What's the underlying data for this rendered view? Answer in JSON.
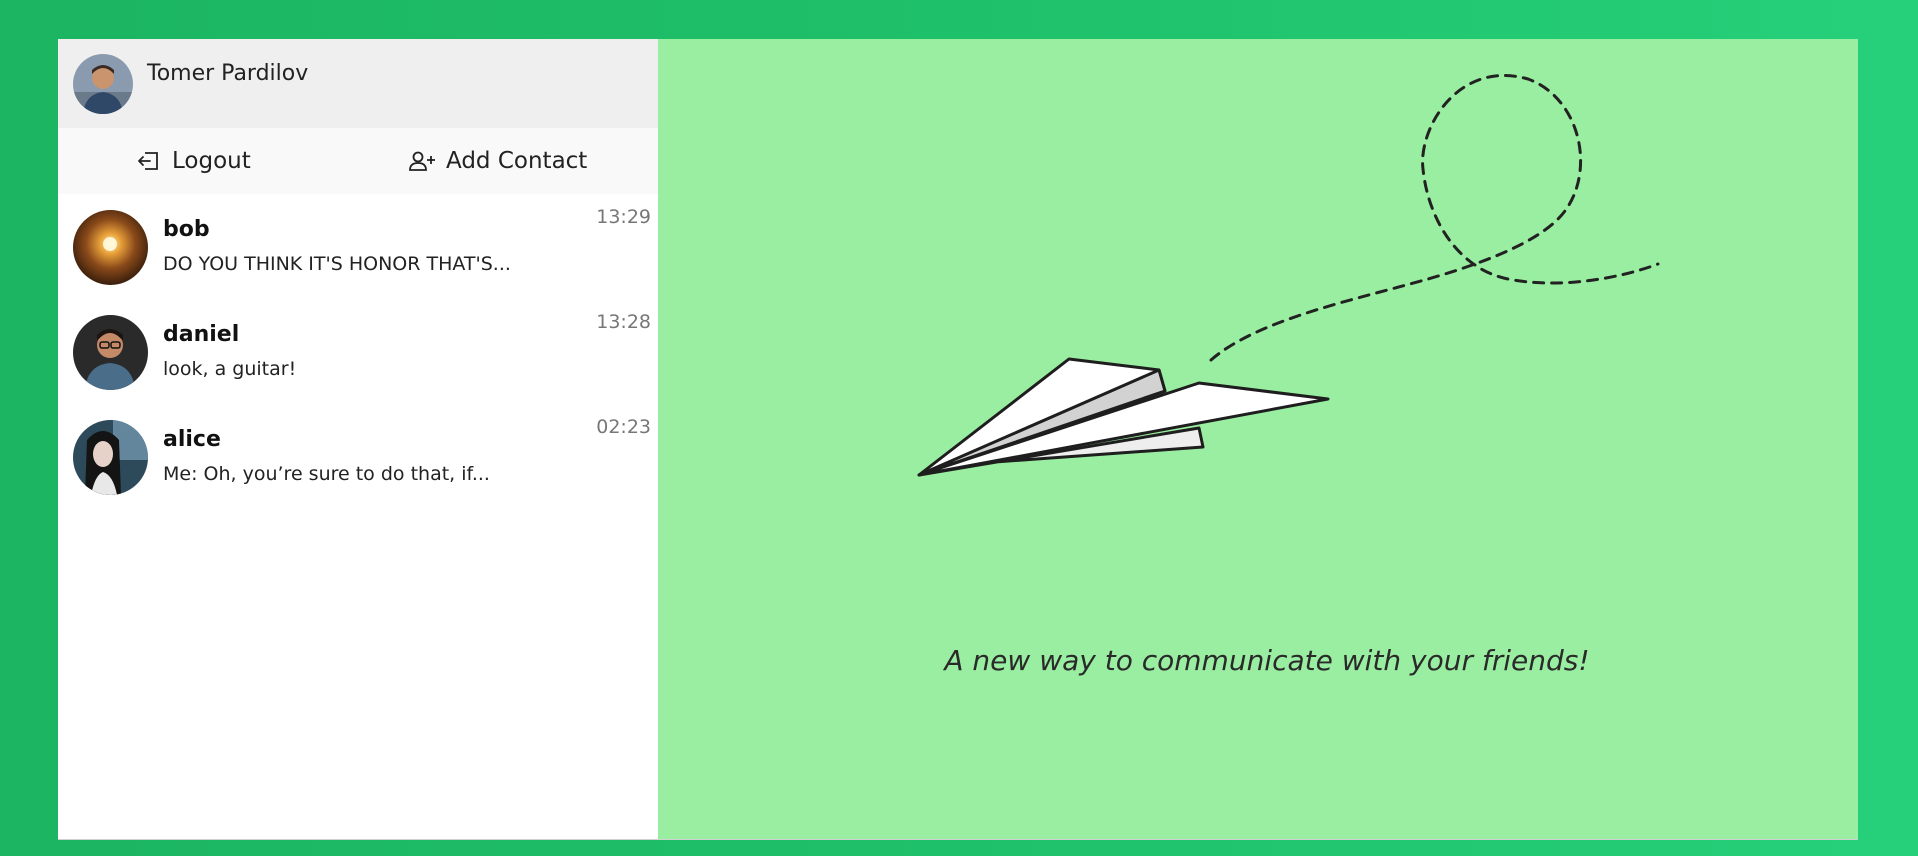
{
  "profile": {
    "name": "Tomer Pardilov"
  },
  "actions": {
    "logout_label": "Logout",
    "add_contact_label": "Add Contact"
  },
  "contacts": [
    {
      "name": "bob",
      "preview": "DO YOU THINK IT'S HONOR THAT'S...",
      "time": "13:29"
    },
    {
      "name": "daniel",
      "preview": "look, a guitar!",
      "time": "13:28"
    },
    {
      "name": "alice",
      "preview": "Me: Oh, you’re sure to do that, if...",
      "time": "02:23"
    }
  ],
  "main": {
    "tagline": "A new way to communicate with your friends!"
  },
  "colors": {
    "background": "#1fc06a",
    "main_panel": "#9aeea1",
    "profile_bar": "#efefef"
  }
}
